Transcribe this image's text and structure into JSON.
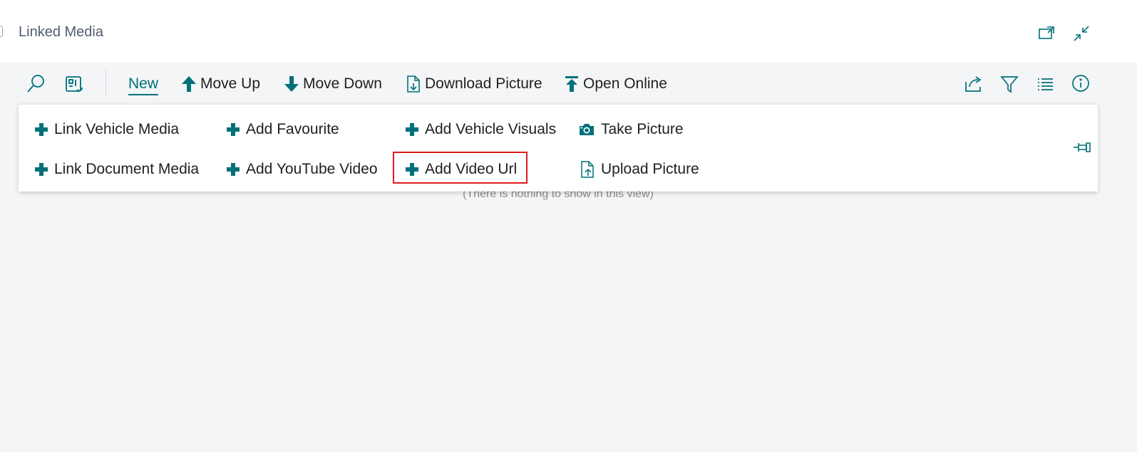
{
  "window": {
    "title": "Linked Media",
    "buttons": [
      {
        "name": "open-in-new-window-icon",
        "label": "Open in new window"
      },
      {
        "name": "collapse-icon",
        "label": "Collapse"
      }
    ]
  },
  "toolbar": {
    "left_icons": [
      "search-icon",
      "layout-icon"
    ],
    "actions": [
      {
        "label": "New",
        "icon": "none",
        "active": true
      },
      {
        "label": "Move Up",
        "icon": "arrow-up-icon"
      },
      {
        "label": "Move Down",
        "icon": "arrow-down-icon"
      },
      {
        "label": "Download Picture",
        "icon": "document-download-icon"
      },
      {
        "label": "Open Online",
        "icon": "upload-arrow-icon"
      }
    ],
    "right_icons": [
      "share-icon",
      "filter-icon",
      "list-view-icon",
      "info-icon"
    ]
  },
  "new_menu": {
    "items": [
      {
        "label": "Link Vehicle Media",
        "icon": "plus-icon"
      },
      {
        "label": "Link Document Media",
        "icon": "plus-icon"
      },
      {
        "label": "Add Favourite",
        "icon": "plus-icon"
      },
      {
        "label": "Add YouTube Video",
        "icon": "plus-icon"
      },
      {
        "label": "Add Vehicle Visuals",
        "icon": "plus-icon"
      },
      {
        "label": "Add Video Url",
        "icon": "plus-icon",
        "highlighted": true
      },
      {
        "label": "Take Picture",
        "icon": "camera-icon"
      },
      {
        "label": "Upload Picture",
        "icon": "document-upload-icon"
      }
    ],
    "pin_icon": "pin-icon"
  },
  "list": {
    "empty_message": "(There is nothing to show in this view)"
  },
  "colors": {
    "accent": "#00707a",
    "highlight": "#e0191c",
    "background": "#f4f5f7"
  }
}
